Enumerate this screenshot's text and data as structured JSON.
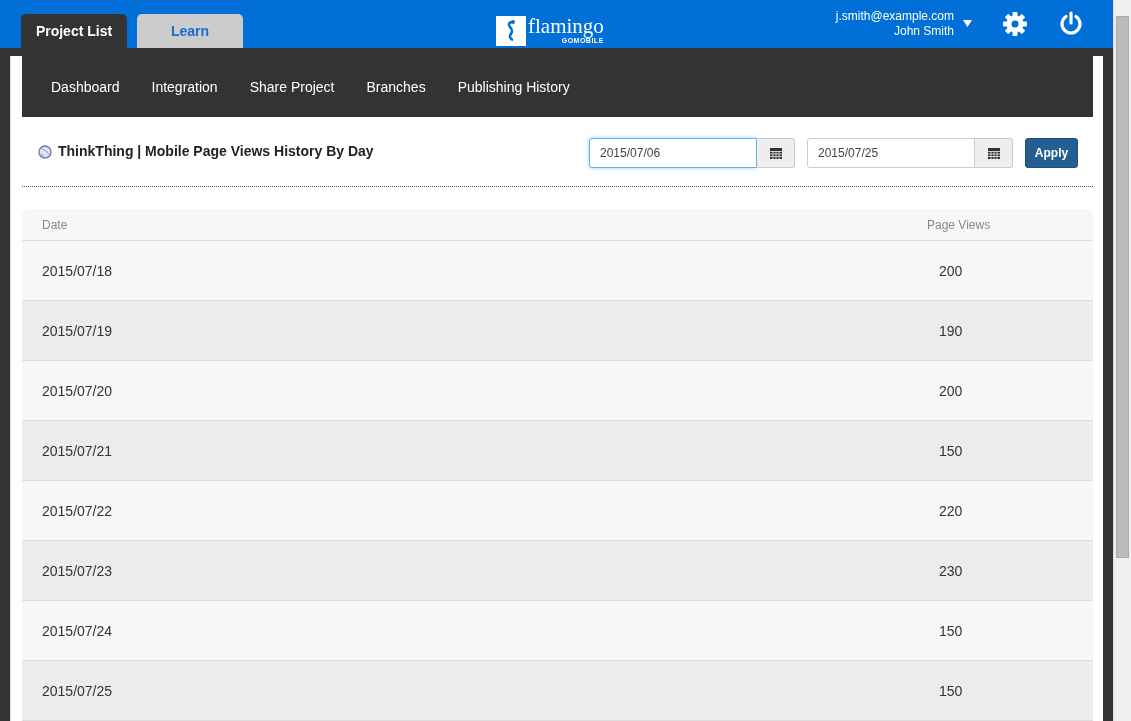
{
  "header": {
    "tabs": [
      {
        "label": "Project List",
        "selected": true
      },
      {
        "label": "Learn",
        "selected": false
      }
    ],
    "logo": {
      "name": "flamingo",
      "tagline": "GOMOBILE"
    },
    "user": {
      "email": "j.smith@example.com",
      "name": "John Smith"
    }
  },
  "nav": [
    "Dashboard",
    "Integration",
    "Share Project",
    "Branches",
    "Publishing History"
  ],
  "report": {
    "title": "ThinkThing | Mobile Page Views History By Day",
    "from": {
      "value": "2015/07/06",
      "focused": true
    },
    "to": {
      "value": "2015/07/25",
      "focused": false
    },
    "apply": "Apply"
  },
  "table": {
    "columns": [
      "Date",
      "Page Views"
    ],
    "rows": [
      [
        "2015/07/18",
        "200"
      ],
      [
        "2015/07/19",
        "190"
      ],
      [
        "2015/07/20",
        "200"
      ],
      [
        "2015/07/21",
        "150"
      ],
      [
        "2015/07/22",
        "220"
      ],
      [
        "2015/07/23",
        "230"
      ],
      [
        "2015/07/24",
        "150"
      ],
      [
        "2015/07/25",
        "150"
      ]
    ]
  }
}
